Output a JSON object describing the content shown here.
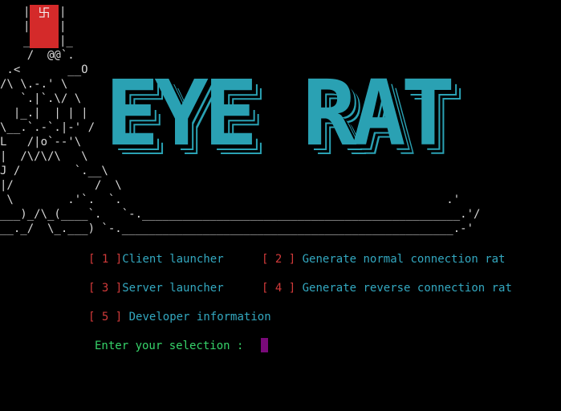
{
  "title": "EYE RAT",
  "logo_symbol": "卐",
  "ascii_art": [
    "    /  @@`.",
    " .<       __O",
    "/\\ \\.-.' \\",
    "   `.|`.\\/ \\",
    "  |_.|  | | |",
    "\\__.`.-`.|-' /",
    "L   /|o`--'\\",
    "|  /\\/\\/\\   \\",
    "J /        `.__\\",
    "|/            /  \\",
    " \\        .'`.  `.                                                .'",
    "___)_/\\_(____`.   `-._______________________________________________.'/",
    "__._/  \\_.___) `-._________________________________________________.-'"
  ],
  "menu": {
    "items": [
      {
        "open": "[",
        "num": "1",
        "close": "]",
        "label": "Client launcher"
      },
      {
        "open": "[",
        "num": "2",
        "close": "]",
        "label": "Generate normal connection rat"
      },
      {
        "open": "[",
        "num": "3",
        "close": "]",
        "label": "Server launcher"
      },
      {
        "open": "[",
        "num": "4",
        "close": "]",
        "label": "Generate reverse connection rat"
      },
      {
        "open": "[",
        "num": "5",
        "close": "]",
        "label": "Developer information"
      }
    ]
  },
  "prompt": {
    "text": "Enter your selection :"
  },
  "colors": {
    "background": "#000000",
    "title": "#2aa1b3",
    "bracket": "#d23a3a",
    "label": "#33a8c0",
    "prompt": "#36d36a",
    "cursor": "#7a0a7a",
    "logo": "#d42a2a"
  }
}
